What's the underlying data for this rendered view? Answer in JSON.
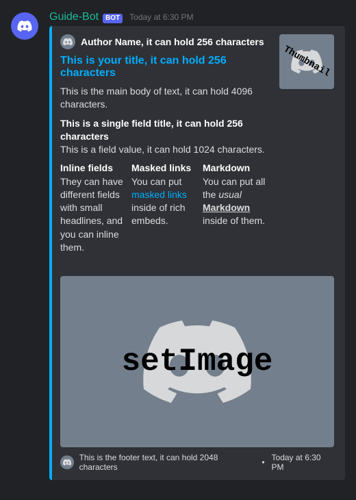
{
  "message": {
    "username": "Guide-Bot",
    "bot_tag": "BOT",
    "timestamp": "Today at 6:30 PM"
  },
  "embed": {
    "accent_color": "#00AEFF",
    "author": {
      "name": "Author Name, it can hold 256 characters",
      "icon": "discord-logo-icon"
    },
    "title": "This is your title, it can hold 256 characters",
    "description": "This is the main body of text, it can hold 4096 characters.",
    "thumbnail": {
      "label": "Thumbnail",
      "icon": "discord-logo-icon"
    },
    "fields": [
      {
        "name": "This is a single field title, it can hold 256 characters",
        "value": "This is a field value, it can hold 1024 characters."
      }
    ],
    "inline_fields": [
      {
        "name": "Inline fields",
        "value": "They can have different fields with small headlines, and you can inline them."
      },
      {
        "name": "Masked links",
        "value_prefix": "You can put ",
        "link_text": "masked links",
        "value_suffix": " inside of rich embeds."
      },
      {
        "name": "Markdown",
        "value_prefix": "You can put all the ",
        "em_text": "usual",
        "space": " ",
        "u_text": "Markdown",
        "value_suffix": " inside of them."
      }
    ],
    "image": {
      "label": "setImage",
      "icon": "discord-logo-icon"
    },
    "footer": {
      "icon": "discord-logo-icon",
      "text": "This is the footer text, it can hold 2048 characters",
      "separator": "•",
      "timestamp": "Today at 6:30 PM"
    }
  }
}
